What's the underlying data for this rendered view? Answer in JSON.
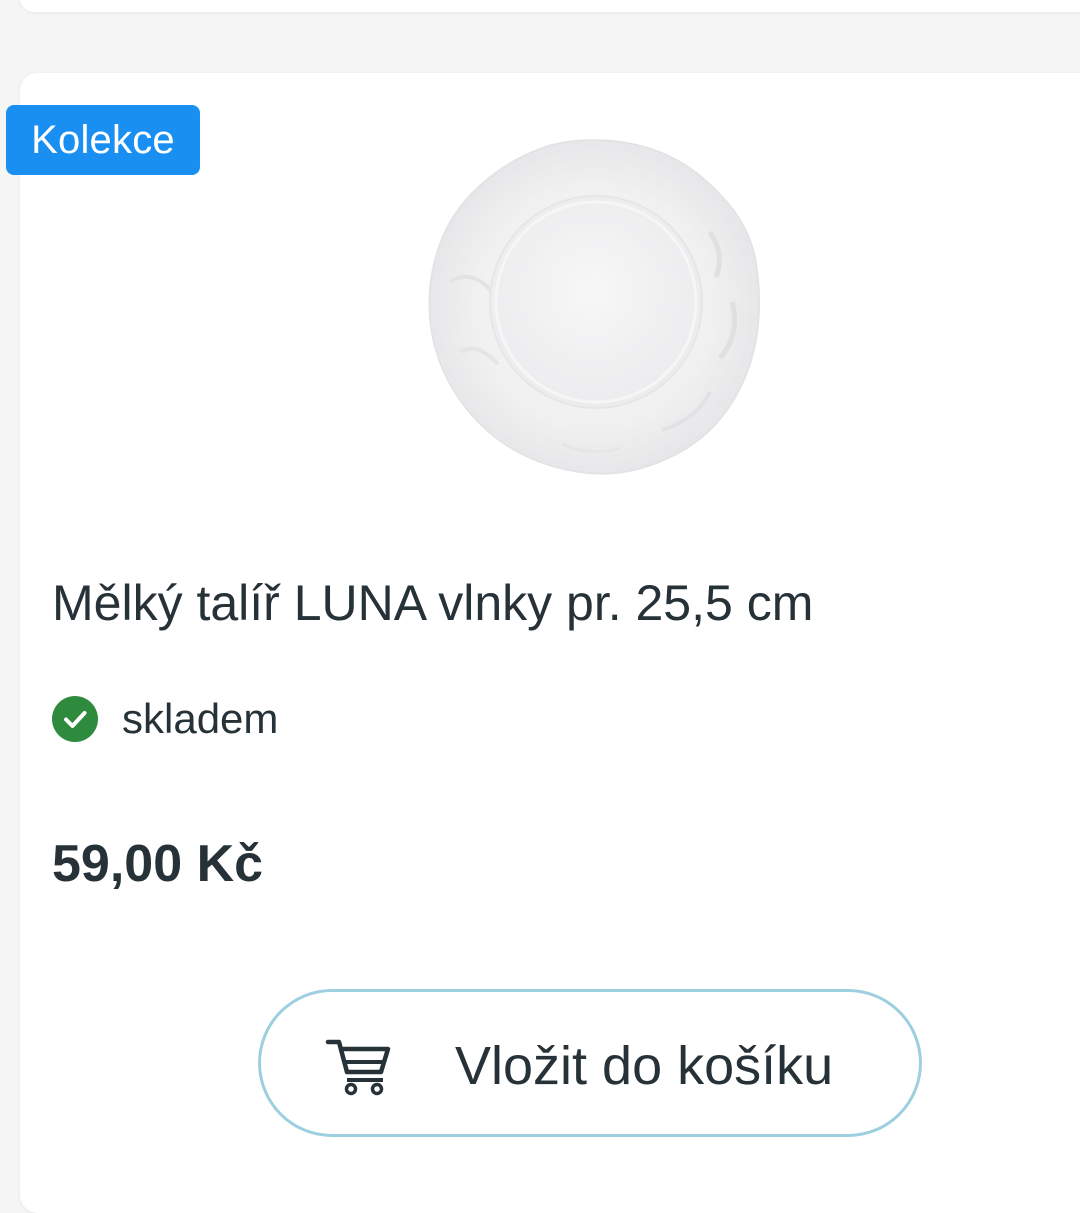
{
  "product": {
    "badge": "Kolekce",
    "image_alt": "white wavy-rim dinner plate",
    "title": "Mělký talíř LUNA vlnky pr. 25,5 cm",
    "stock_status": "skladem",
    "price": "59,00 Kč",
    "add_to_cart_label": "Vložit do košíku"
  },
  "icons": {
    "stock": "check-circle-icon",
    "cart": "shopping-cart-icon"
  },
  "colors": {
    "badge_bg": "#1a8ff2",
    "stock_ok": "#2e8b3e",
    "button_border": "#9dcfe1",
    "text": "#263238"
  }
}
